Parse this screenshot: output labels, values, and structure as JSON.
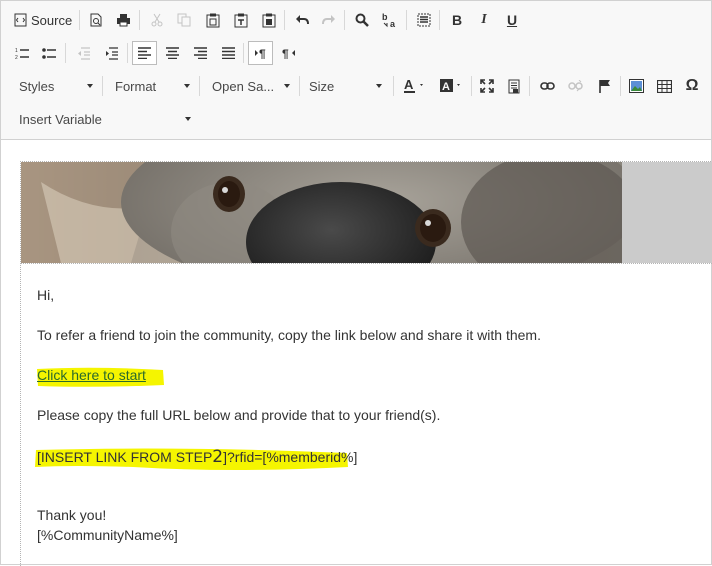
{
  "toolbar": {
    "source_label": "Source",
    "styles_label": "Styles",
    "format_label": "Format",
    "font_label": "Open Sa...",
    "size_label": "Size",
    "insert_variable_label": "Insert Variable"
  },
  "content": {
    "greeting": "Hi,",
    "intro": "To refer a friend to join the community, copy the link below and share it with them.",
    "link_text": "Click here to start",
    "instruction": "Please copy the full URL below and provide that to your friend(s).",
    "url_text_a": "[INSERT LINK FROM STEP",
    "url_step": "2",
    "url_text_b": "]?rfid=[%memberid%]",
    "thanks": "Thank you!",
    "signature": "[%CommunityName%]"
  },
  "colors": {
    "highlight": "#f5f500",
    "link": "#2b6a2b"
  }
}
